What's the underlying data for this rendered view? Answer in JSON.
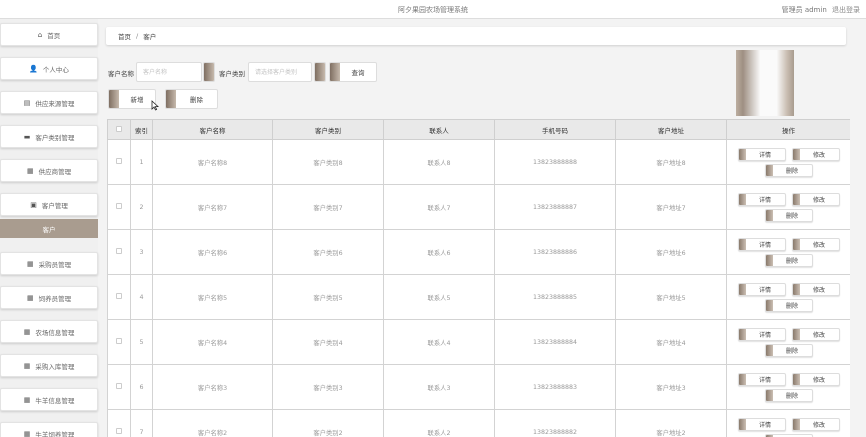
{
  "header": {
    "title": "阿夕果园农场管理系统",
    "user_text": "管理员 admin",
    "logout": "退出登录"
  },
  "sidebar": {
    "items": [
      {
        "label": "首页",
        "icon": "home-icon",
        "glyph": "⌂"
      },
      {
        "label": "个人中心",
        "icon": "person-icon",
        "glyph": "👤"
      },
      {
        "label": "供应来源管理",
        "icon": "document-icon",
        "glyph": "▤"
      },
      {
        "label": "客户类别管理",
        "icon": "monitor-icon",
        "glyph": "▬"
      },
      {
        "label": "供应商管理",
        "icon": "grid-icon",
        "glyph": "▦"
      },
      {
        "label": "客户管理",
        "icon": "folder-icon",
        "glyph": "▣"
      },
      {
        "label": "采购员管理",
        "icon": "grid-icon",
        "glyph": "▦"
      },
      {
        "label": "饲养员管理",
        "icon": "grid-icon",
        "glyph": "▦"
      },
      {
        "label": "农场信息管理",
        "icon": "grid-icon",
        "glyph": "▦"
      },
      {
        "label": "采购入库管理",
        "icon": "grid-icon",
        "glyph": "▦"
      },
      {
        "label": "牛羊信息管理",
        "icon": "grid-icon",
        "glyph": "▦"
      },
      {
        "label": "牛羊饲养管理",
        "icon": "grid-icon",
        "glyph": "▦"
      }
    ],
    "active_sub": "客户"
  },
  "breadcrumb": {
    "home": "首页",
    "separator": "/",
    "current": "客户"
  },
  "filters": {
    "name_label": "客户名称",
    "name_placeholder": "客户名称",
    "type_label": "客户类别",
    "type_placeholder": "请选择客户类别",
    "search_button": "查询"
  },
  "actions": {
    "add": "新增",
    "delete": "删除"
  },
  "table": {
    "headers": [
      "索引",
      "客户名称",
      "客户类别",
      "联系人",
      "手机号码",
      "客户地址",
      "操作"
    ],
    "rows": [
      {
        "index": "1",
        "name": "客户名称8",
        "type": "客户类别8",
        "contact": "联系人8",
        "phone": "13823888888",
        "address": "客户地址8"
      },
      {
        "index": "2",
        "name": "客户名称7",
        "type": "客户类别7",
        "contact": "联系人7",
        "phone": "13823888887",
        "address": "客户地址7"
      },
      {
        "index": "3",
        "name": "客户名称6",
        "type": "客户类别6",
        "contact": "联系人6",
        "phone": "13823888886",
        "address": "客户地址6"
      },
      {
        "index": "4",
        "name": "客户名称5",
        "type": "客户类别5",
        "contact": "联系人5",
        "phone": "13823888885",
        "address": "客户地址5"
      },
      {
        "index": "5",
        "name": "客户名称4",
        "type": "客户类别4",
        "contact": "联系人4",
        "phone": "13823888884",
        "address": "客户地址4"
      },
      {
        "index": "6",
        "name": "客户名称3",
        "type": "客户类别3",
        "contact": "联系人3",
        "phone": "13823888883",
        "address": "客户地址3"
      },
      {
        "index": "7",
        "name": "客户名称2",
        "type": "客户类别2",
        "contact": "联系人2",
        "phone": "13823888882",
        "address": "客户地址2"
      }
    ],
    "op_labels": {
      "detail": "详情",
      "edit": "修改",
      "delete": "删除"
    }
  }
}
